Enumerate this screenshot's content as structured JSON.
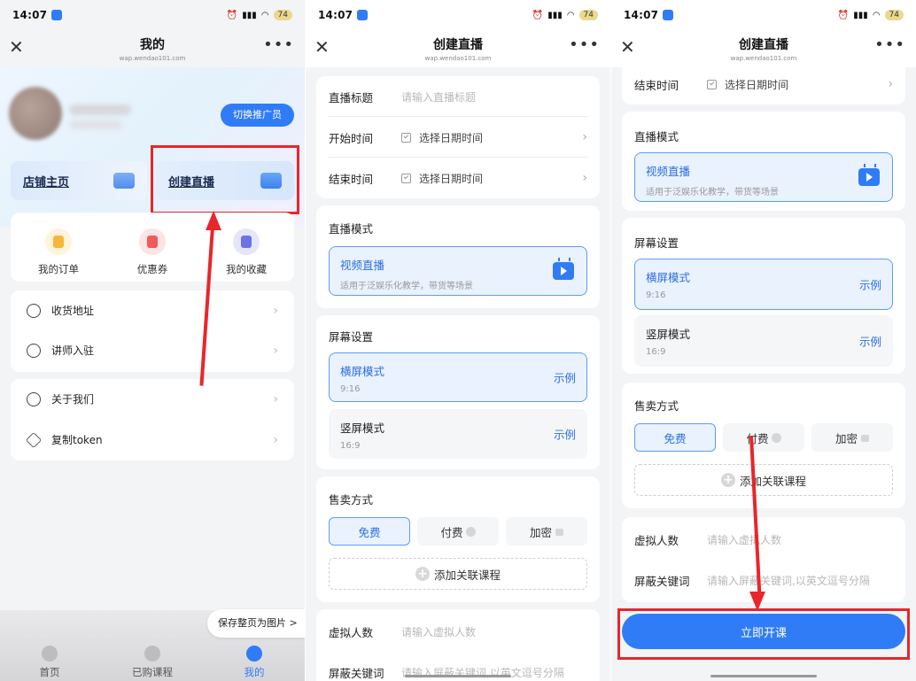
{
  "status": {
    "time": "14:07",
    "battery": "74"
  },
  "panel1": {
    "nav_title": "我的",
    "nav_sub": "wap.wendao101.com",
    "switch_label": "切换推广员",
    "tiles": [
      {
        "label": "店铺主页"
      },
      {
        "label": "创建直播"
      }
    ],
    "shortcuts": [
      {
        "label": "我的订单"
      },
      {
        "label": "优惠券"
      },
      {
        "label": "我的收藏"
      }
    ],
    "list1": [
      {
        "label": "收货地址"
      },
      {
        "label": "讲师入驻"
      }
    ],
    "list2": [
      {
        "label": "关于我们"
      },
      {
        "label": "复制token"
      }
    ],
    "save_label": "保存整页为图片 >",
    "tabs": [
      {
        "label": "首页"
      },
      {
        "label": "已购课程"
      },
      {
        "label": "我的"
      }
    ]
  },
  "panel2": {
    "nav_title": "创建直播",
    "nav_sub": "wap.wendao101.com",
    "form": {
      "title_label": "直播标题",
      "title_placeholder": "请输入直播标题",
      "start_label": "开始时间",
      "end_label": "结束时间",
      "date_placeholder": "选择日期时间"
    },
    "mode": {
      "section": "直播模式",
      "title": "视频直播",
      "desc": "适用于泛娱乐化教学，带货等场景"
    },
    "screen": {
      "section": "屏幕设置",
      "options": [
        {
          "title": "横屏模式",
          "ratio": "9:16",
          "example": "示例"
        },
        {
          "title": "竖屏模式",
          "ratio": "16:9",
          "example": "示例"
        }
      ]
    },
    "sale": {
      "section": "售卖方式",
      "options": [
        "免费",
        "付费",
        "加密"
      ],
      "add_course": "添加关联课程"
    },
    "virtual": {
      "label": "虚拟人数",
      "placeholder": "请输入虚拟人数"
    },
    "keywords": {
      "label": "屏蔽关键词",
      "placeholder": "请输入屏蔽关键词,以英文逗号分隔"
    }
  },
  "panel3": {
    "start_button": "立即开课"
  }
}
